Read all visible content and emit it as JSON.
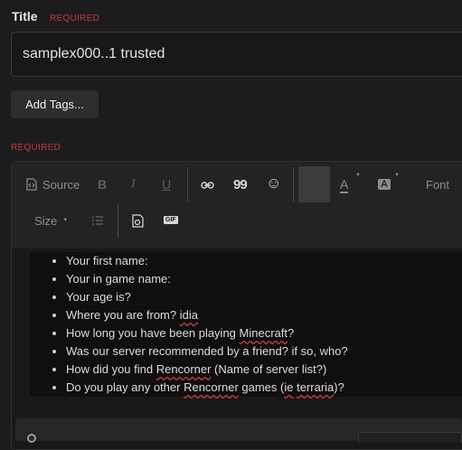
{
  "form": {
    "title_label": "Title",
    "required_label": "REQUIRED",
    "title_value": "samplex000..1  trusted",
    "add_tags_label": "Add Tags...",
    "body_required_label": "REQUIRED"
  },
  "toolbar": {
    "source_label": "Source",
    "bold_label": "B",
    "italic_label": "I",
    "underline_label": "U",
    "link_icon": "link-icon",
    "quote_label": "99",
    "smiley_label": "☺",
    "text_color_label": "A",
    "bg_color_label": "A",
    "font_label": "Font",
    "size_label": "Size",
    "list_icon": "numbered-list-icon",
    "image_icon": "image-icon",
    "gif_label": "GIF"
  },
  "content": {
    "items": [
      [
        "Your first name:"
      ],
      [
        "Your in game name:"
      ],
      [
        "Your age is?"
      ],
      [
        "Where you are from? ",
        "idia"
      ],
      [
        "How long you have been playing ",
        "Minecraft",
        "?"
      ],
      [
        "Was our server recommended by a friend? if so, who?"
      ],
      [
        "How did you find ",
        "Rencorner",
        " (Name of server list?)"
      ],
      [
        "Do you play any other ",
        "Rencorner",
        " games (",
        "ie",
        "  ",
        "terraria",
        ")?"
      ]
    ]
  },
  "colors": {
    "background": "#1c1c1c",
    "required": "#c23a3a",
    "spellcheck": "#d83b3b"
  }
}
